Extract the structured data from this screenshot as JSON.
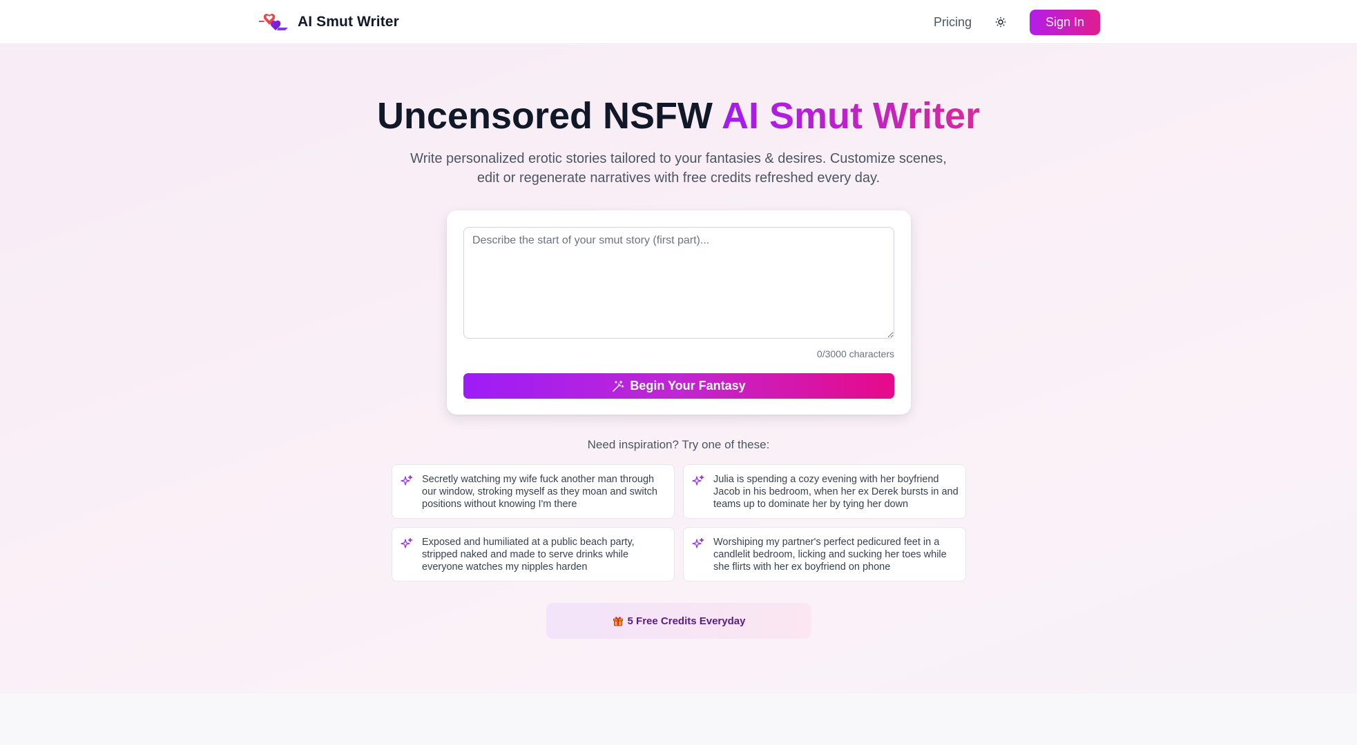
{
  "header": {
    "brand": "AI Smut Writer",
    "nav_pricing": "Pricing",
    "signin_label": "Sign In",
    "theme_icon": "sun-icon"
  },
  "hero": {
    "title_main": "Uncensored NSFW ",
    "title_accent": "AI Smut Writer",
    "subtitle": "Write personalized erotic stories tailored to your fantasies & desires. Customize scenes, edit or regenerate narratives with free credits refreshed every day."
  },
  "composer": {
    "value": "",
    "placeholder": "Describe the start of your smut story (first part)...",
    "char_count": "0/3000 characters",
    "submit_label": "Begin Your Fantasy",
    "submit_icon": "magic-wand-icon"
  },
  "inspiration": {
    "label": "Need inspiration? Try one of these:",
    "items": [
      "Secretly watching my wife fuck another man through our window, stroking myself as they moan and switch positions without knowing I'm there",
      "Julia is spending a cozy evening with her boyfriend Jacob in his bedroom, when her ex Derek bursts in and teams up to dominate her by tying her down",
      "Exposed and humiliated at a public beach party, stripped naked and made to serve drinks while everyone watches my nipples harden",
      "Worshiping my partner's perfect pedicured feet in a candlelit bedroom, licking and sucking her toes while she flirts with her ex boyfriend on phone"
    ]
  },
  "credits": {
    "label": "5 Free Credits Everyday",
    "icon": "gift-icon"
  },
  "colors": {
    "accent_start": "#9d1cf7",
    "accent_end": "#e7098a",
    "credits_text": "#581c87"
  }
}
